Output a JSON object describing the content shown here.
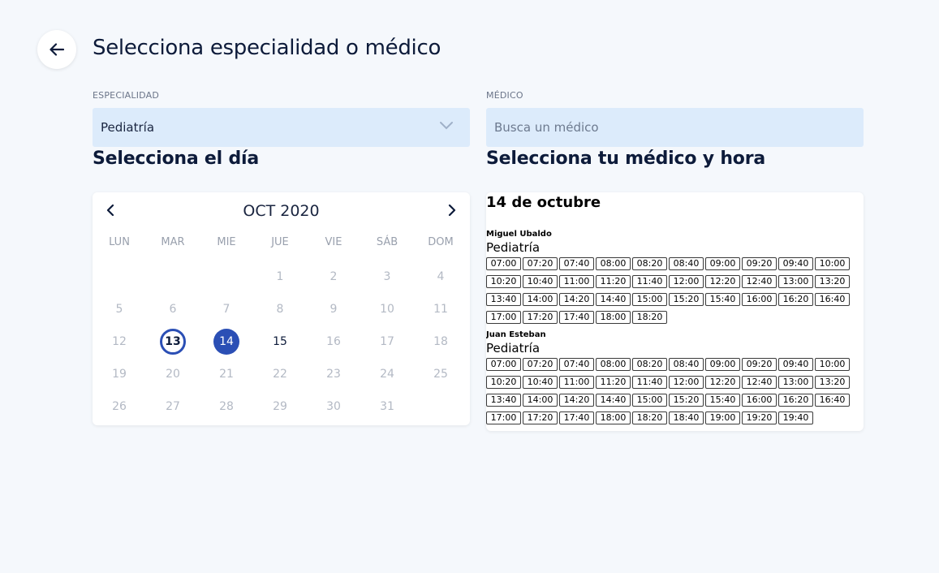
{
  "page": {
    "title": "Selecciona especialidad o médico"
  },
  "specialty": {
    "label": "ESPECIALIDAD",
    "value": "Pediatría"
  },
  "doctor_search": {
    "label": "MÉDICO",
    "placeholder": "Busca un médico"
  },
  "day_section": {
    "title": "Selecciona el día"
  },
  "doctor_section": {
    "title": "Selecciona tu médico y hora"
  },
  "calendar": {
    "month_label": "OCT 2020",
    "weekdays": [
      "LUN",
      "MAR",
      "MIE",
      "JUE",
      "VIE",
      "SÁB",
      "DOM"
    ],
    "weeks": [
      [
        "",
        "",
        "",
        "1",
        "2",
        "3",
        "4"
      ],
      [
        "5",
        "6",
        "7",
        "8",
        "9",
        "10",
        "11"
      ],
      [
        "12",
        "13",
        "14",
        "15",
        "16",
        "17",
        "18"
      ],
      [
        "19",
        "20",
        "21",
        "22",
        "23",
        "24",
        "25"
      ],
      [
        "26",
        "27",
        "28",
        "29",
        "30",
        "31",
        ""
      ]
    ],
    "today": "13",
    "selected": "14",
    "available": [
      "13",
      "14",
      "15"
    ]
  },
  "schedule": {
    "date_label": "14 de octubre",
    "doctors": [
      {
        "name": "Miguel Ubaldo",
        "specialty": "Pediatría",
        "slots": [
          "07:00",
          "07:20",
          "07:40",
          "08:00",
          "08:20",
          "08:40",
          "09:00",
          "09:20",
          "09:40",
          "10:00",
          "10:20",
          "10:40",
          "11:00",
          "11:20",
          "11:40",
          "12:00",
          "12:20",
          "12:40",
          "13:00",
          "13:20",
          "13:40",
          "14:00",
          "14:20",
          "14:40",
          "15:00",
          "15:20",
          "15:40",
          "16:00",
          "16:20",
          "16:40",
          "17:00",
          "17:20",
          "17:40",
          "18:00",
          "18:20"
        ]
      },
      {
        "name": "Juan Esteban",
        "specialty": "Pediatría",
        "slots": [
          "07:00",
          "07:20",
          "07:40",
          "08:00",
          "08:20",
          "08:40",
          "09:00",
          "09:20",
          "09:40",
          "10:00",
          "10:20",
          "10:40",
          "11:00",
          "11:20",
          "11:40",
          "12:00",
          "12:20",
          "12:40",
          "13:00",
          "13:20",
          "13:40",
          "14:00",
          "14:20",
          "14:40",
          "15:00",
          "15:20",
          "15:40",
          "16:00",
          "16:20",
          "16:40",
          "17:00",
          "17:20",
          "17:40",
          "18:00",
          "18:20",
          "18:40",
          "19:00",
          "19:20",
          "19:40"
        ]
      }
    ]
  },
  "colors": {
    "accent": "#2b4fb5",
    "input_bg": "#dcebfb",
    "page_bg": "#f5f8fc"
  },
  "icons": {
    "back": "arrow-left-icon",
    "dropdown": "chevron-down-icon",
    "prev": "chevron-left-icon",
    "next": "chevron-right-icon"
  }
}
